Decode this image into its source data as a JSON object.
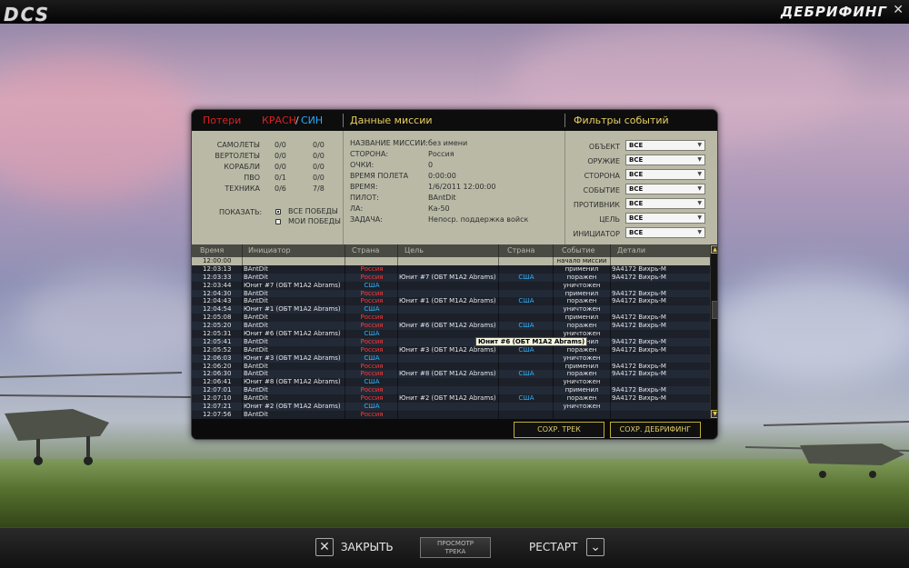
{
  "app": {
    "logo": "DCS",
    "screen_title": "ДЕБРИФИНГ",
    "close_glyph": "✕"
  },
  "panel": {
    "losses_label": "Потери",
    "red_label": "КРАСН",
    "separator": "/",
    "blue_label": "СИН",
    "mission_title": "Данные миссии",
    "filters_title": "Фильтры событий"
  },
  "losses": {
    "rows": [
      {
        "label": "САМОЛЕТЫ",
        "red": "0/0",
        "blue": "0/0"
      },
      {
        "label": "ВЕРТОЛЕТЫ",
        "red": "0/0",
        "blue": "0/0"
      },
      {
        "label": "КОРАБЛИ",
        "red": "0/0",
        "blue": "0/0"
      },
      {
        "label": "ПВО",
        "red": "0/1",
        "blue": "0/0"
      },
      {
        "label": "ТЕХНИКА",
        "red": "0/6",
        "blue": "7/8"
      }
    ],
    "show_label": "ПОКАЗАТЬ:",
    "options": [
      {
        "label": "ВСЕ ПОБЕДЫ",
        "selected": true
      },
      {
        "label": "МОИ ПОБЕДЫ",
        "selected": false
      }
    ]
  },
  "mission": {
    "fields": [
      {
        "label": "НАЗВАНИЕ МИССИИ:",
        "value": "без имени"
      },
      {
        "label": "СТОРОНА:",
        "value": "Россия"
      },
      {
        "label": "ОЧКИ:",
        "value": "0"
      },
      {
        "label": "ВРЕМЯ ПОЛЕТА",
        "value": "0:00:00"
      },
      {
        "label": "ВРЕМЯ:",
        "value": "1/6/2011   12:00:00"
      },
      {
        "label": "ПИЛОТ:",
        "value": "BAntDit"
      },
      {
        "label": "ЛА:",
        "value": "Ка-50"
      },
      {
        "label": "ЗАДАЧА:",
        "value": "Непоср. поддержка войск"
      }
    ]
  },
  "filters": [
    {
      "label": "ОБЪЕКТ",
      "value": "ВСЕ"
    },
    {
      "label": "ОРУЖИЕ",
      "value": "ВСЕ"
    },
    {
      "label": "СТОРОНА",
      "value": "ВСЕ"
    },
    {
      "label": "СОБЫТИЕ",
      "value": "ВСЕ"
    },
    {
      "label": "ПРОТИВНИК",
      "value": "ВСЕ"
    },
    {
      "label": "ЦЕЛЬ",
      "value": "ВСЕ"
    },
    {
      "label": "ИНИЦИАТОР",
      "value": "ВСЕ"
    }
  ],
  "table": {
    "headers": [
      "Время",
      "Инициатор",
      "Страна",
      "Цель",
      "Страна",
      "Событие",
      "Детали"
    ],
    "rows": [
      [
        "12:00:00",
        "",
        "",
        "",
        "",
        "начало миссии",
        ""
      ],
      [
        "12:03:13",
        "BAntDit",
        "Россия",
        "",
        "",
        "применил",
        "9А4172 Вихрь-М"
      ],
      [
        "12:03:33",
        "BAntDit",
        "Россия",
        "Юнит #7 (ОБТ M1A2 Abrams)",
        "США",
        "поражен",
        "9А4172 Вихрь-М"
      ],
      [
        "12:03:44",
        "Юнит #7 (ОБТ M1A2 Abrams)",
        "США",
        "",
        "",
        "уничтожен",
        ""
      ],
      [
        "12:04:30",
        "BAntDit",
        "Россия",
        "",
        "",
        "применил",
        "9А4172 Вихрь-М"
      ],
      [
        "12:04:43",
        "BAntDit",
        "Россия",
        "Юнит #1 (ОБТ M1A2 Abrams)",
        "США",
        "поражен",
        "9А4172 Вихрь-М"
      ],
      [
        "12:04:54",
        "Юнит #1 (ОБТ M1A2 Abrams)",
        "США",
        "",
        "",
        "уничтожен",
        ""
      ],
      [
        "12:05:08",
        "BAntDit",
        "Россия",
        "",
        "",
        "применил",
        "9А4172 Вихрь-М"
      ],
      [
        "12:05:20",
        "BAntDit",
        "Россия",
        "Юнит #6 (ОБТ M1A2 Abrams)",
        "США",
        "поражен",
        "9А4172 Вихрь-М"
      ],
      [
        "12:05:31",
        "Юнит #6 (ОБТ M1A2 Abrams)",
        "США",
        "",
        "",
        "уничтожен",
        ""
      ],
      [
        "12:05:41",
        "BAntDit",
        "Россия",
        "",
        "",
        "применил",
        "9А4172 Вихрь-М"
      ],
      [
        "12:05:52",
        "BAntDit",
        "Россия",
        "Юнит #3 (ОБТ M1A2 Abrams)",
        "США",
        "поражен",
        "9А4172 Вихрь-М"
      ],
      [
        "12:06:03",
        "Юнит #3 (ОБТ M1A2 Abrams)",
        "США",
        "",
        "",
        "уничтожен",
        ""
      ],
      [
        "12:06:20",
        "BAntDit",
        "Россия",
        "",
        "",
        "применил",
        "9А4172 Вихрь-М"
      ],
      [
        "12:06:30",
        "BAntDit",
        "Россия",
        "Юнит #8 (ОБТ M1A2 Abrams)",
        "США",
        "поражен",
        "9А4172 Вихрь-М"
      ],
      [
        "12:06:41",
        "Юнит #8 (ОБТ M1A2 Abrams)",
        "США",
        "",
        "",
        "уничтожен",
        ""
      ],
      [
        "12:07:01",
        "BAntDit",
        "Россия",
        "",
        "",
        "применил",
        "9А4172 Вихрь-М"
      ],
      [
        "12:07:10",
        "BAntDit",
        "Россия",
        "Юнит #2 (ОБТ M1A2 Abrams)",
        "США",
        "поражен",
        "9А4172 Вихрь-М"
      ],
      [
        "12:07:21",
        "Юнит #2 (ОБТ M1A2 Abrams)",
        "США",
        "",
        "",
        "уничтожен",
        ""
      ],
      [
        "12:07:56",
        "BAntDit",
        "Россия",
        "",
        "",
        "",
        ""
      ]
    ],
    "tooltip": "Юнит #6 (ОБТ M1A2 Abrams)"
  },
  "footer": {
    "save_track": "СОХР. ТРЕК",
    "save_debrief": "СОХР. ДЕБРИФИНГ"
  },
  "bottom": {
    "close_label": "ЗАКРЫТЬ",
    "close_icon": "✕",
    "view_track_line1": "ПРОСМОТР",
    "view_track_line2": "ТРЕКА",
    "restart_label": "РЕСТАРТ",
    "restart_icon": "⌄"
  },
  "colors": {
    "red_side": "#e02020",
    "blue_side": "#2aa9ff",
    "accent": "#e8d060"
  }
}
